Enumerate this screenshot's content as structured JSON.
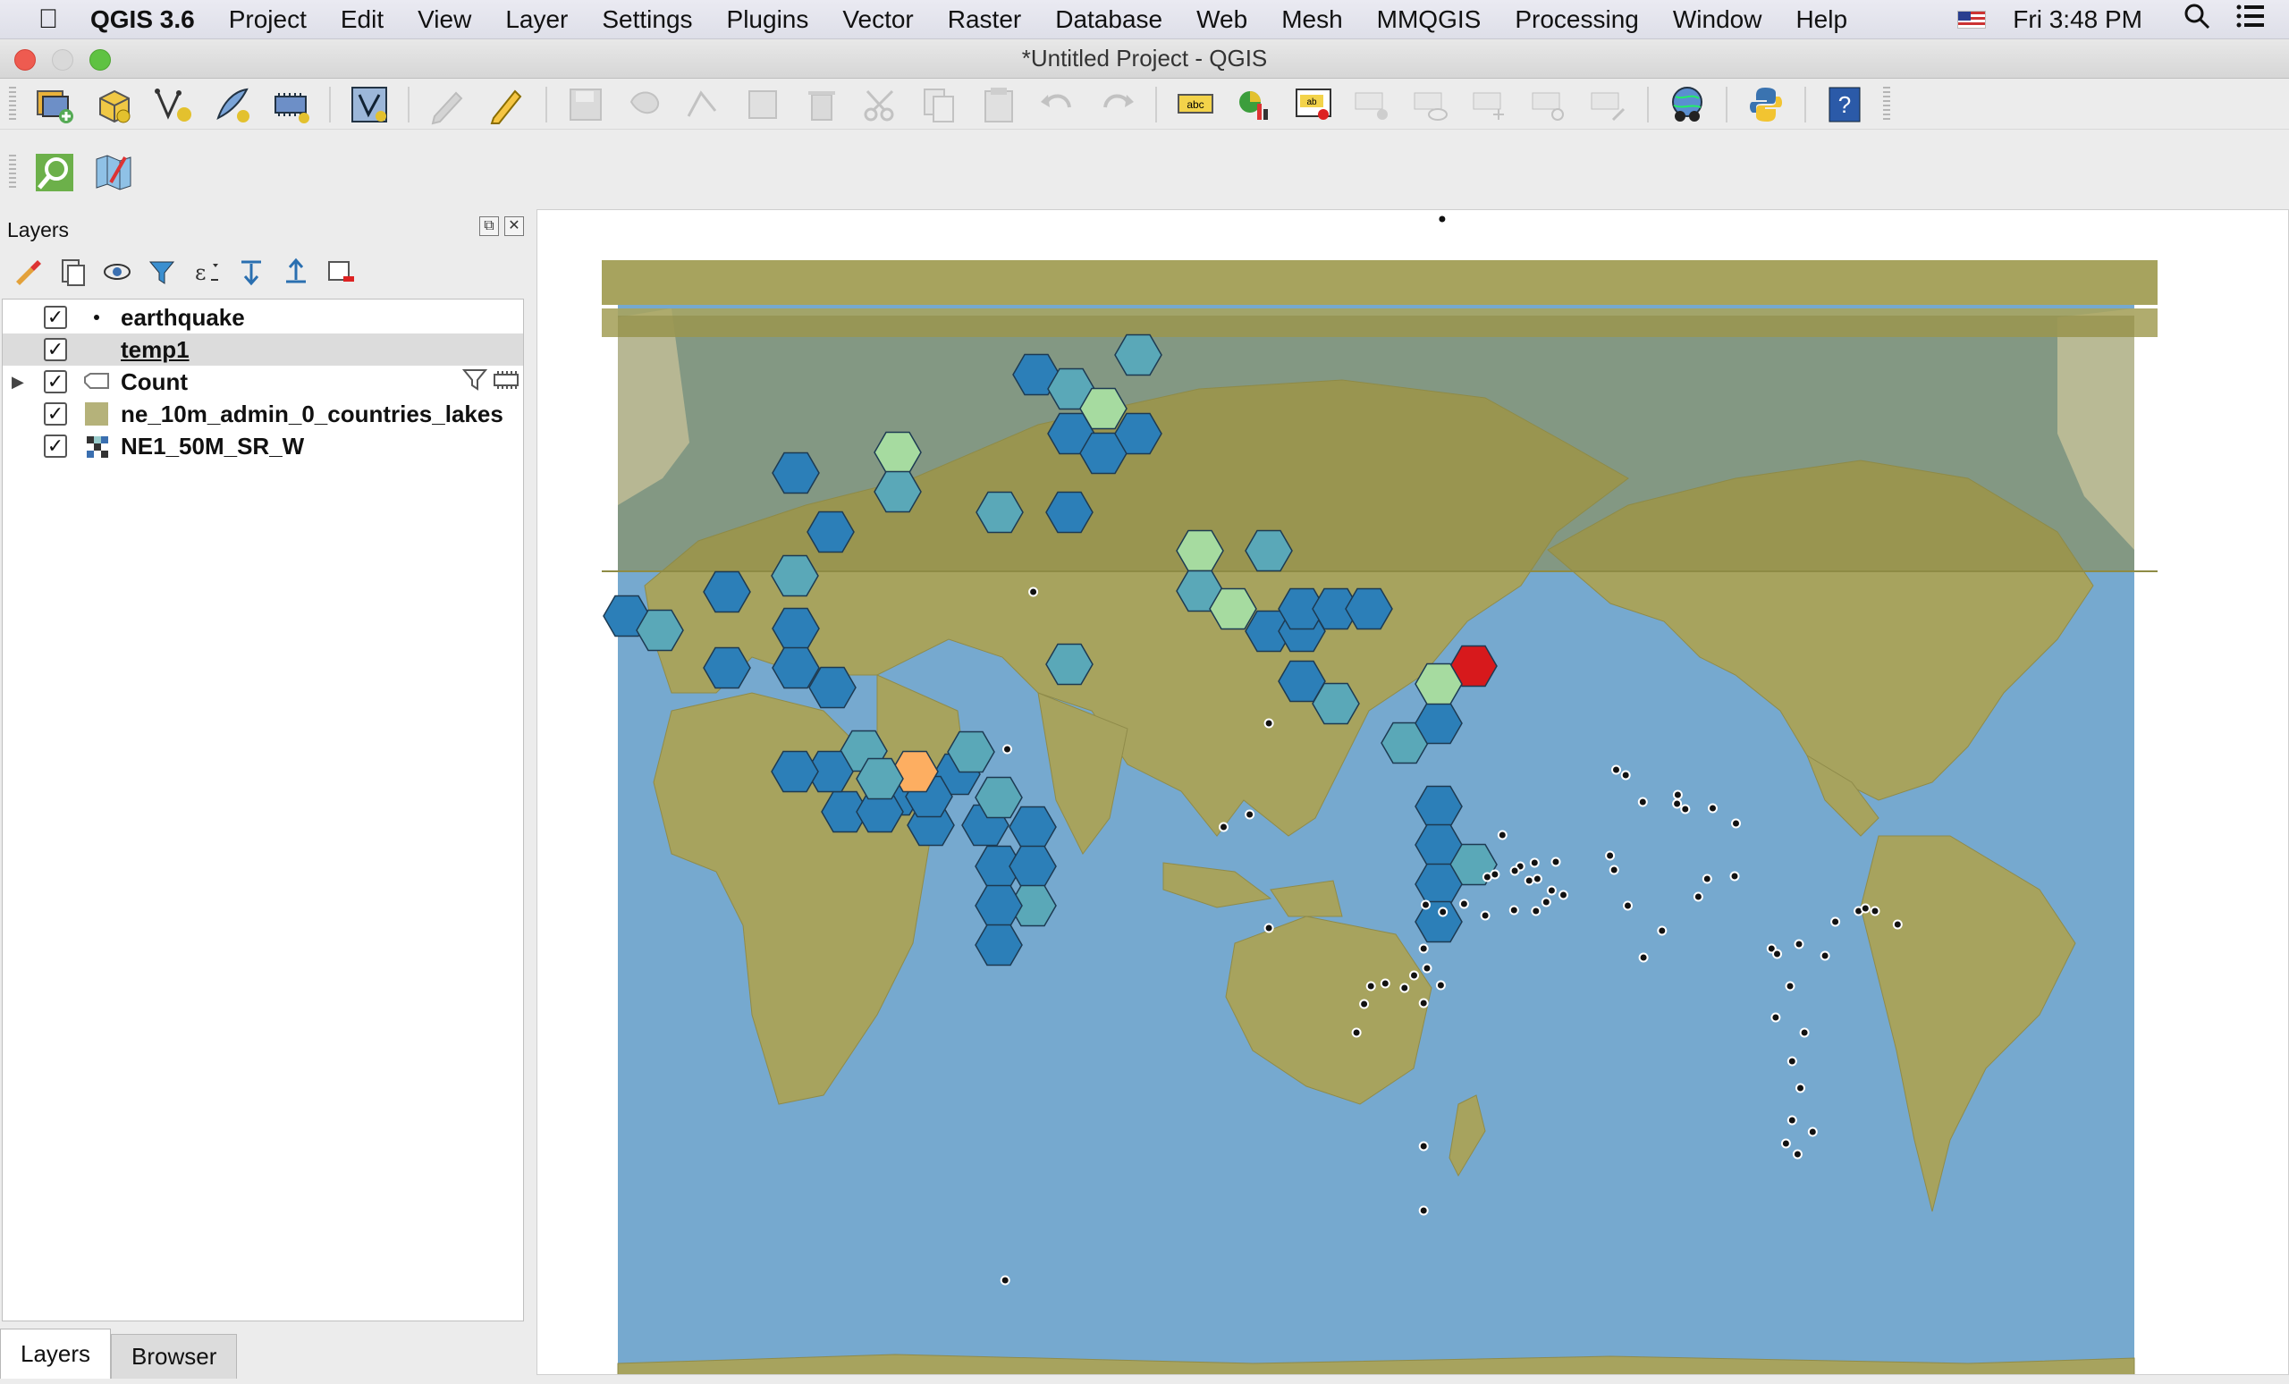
{
  "menubar": {
    "apple_icon": "apple-logo-icon",
    "app_name": "QGIS 3.6",
    "items": [
      "Project",
      "Edit",
      "View",
      "Layer",
      "Settings",
      "Plugins",
      "Vector",
      "Raster",
      "Database",
      "Web",
      "Mesh",
      "MMQGIS",
      "Processing",
      "Window",
      "Help"
    ],
    "clock": "Fri 3:48 PM"
  },
  "window": {
    "title": "*Untitled Project - QGIS"
  },
  "layers_panel": {
    "title": "Layers",
    "layers": [
      {
        "name": "earthquake",
        "checked": true,
        "icon": "point-symbol-icon",
        "selected": false
      },
      {
        "name": "temp1",
        "checked": true,
        "icon": "none",
        "selected": true
      },
      {
        "name": "Count",
        "checked": true,
        "icon": "graduated-symbol-icon",
        "selected": false,
        "expandable": true
      },
      {
        "name": "ne_10m_admin_0_countries_lakes",
        "checked": true,
        "icon": "polygon-fill-icon",
        "selected": false
      },
      {
        "name": "NE1_50M_SR_W",
        "checked": true,
        "icon": "raster-icon",
        "selected": false
      }
    ],
    "check_mark": "✓",
    "tabs": [
      "Layers",
      "Browser"
    ]
  },
  "colors": {
    "ocean": "#76a9cf",
    "land": "#a7a35e",
    "overlay": "#8e8b45",
    "hex_dark": "#2c7fb8",
    "hex_mid": "#5aa8b8",
    "hex_light": "#a6dba0",
    "hex_orange": "#fdae61",
    "hex_red": "#d7191c"
  }
}
